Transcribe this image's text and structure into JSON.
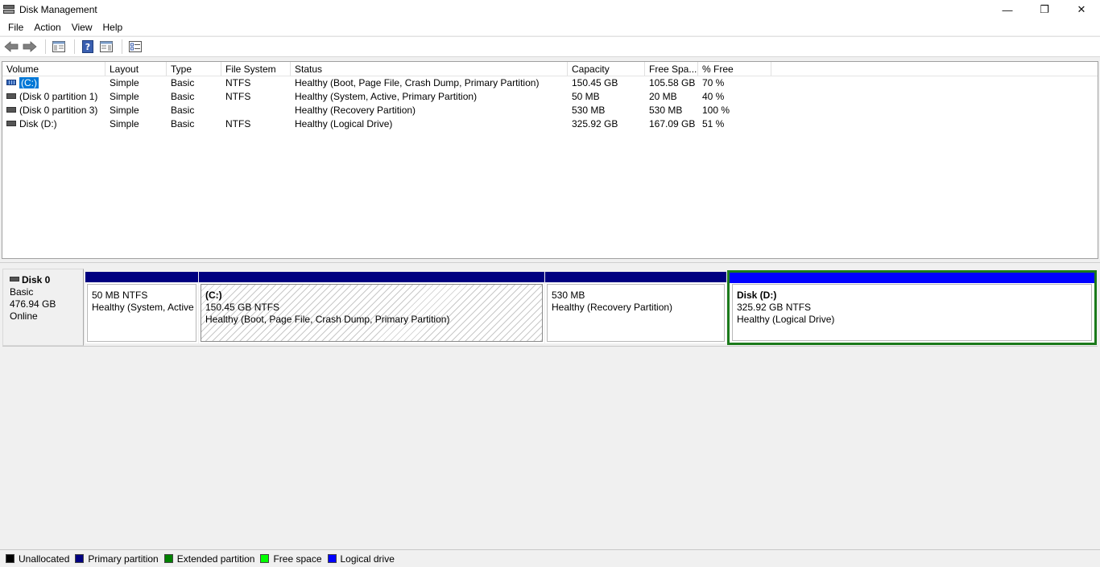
{
  "window": {
    "title": "Disk Management",
    "controls": {
      "minimize": "—",
      "restore": "❐",
      "close": "✕"
    }
  },
  "menu": [
    "File",
    "Action",
    "View",
    "Help"
  ],
  "toolbar": {
    "icons": [
      "back-arrow-icon",
      "forward-arrow-icon",
      "console-tree-icon",
      "help-icon",
      "action-pane-icon",
      "properties-icon"
    ]
  },
  "volume_list": {
    "columns": [
      "Volume",
      "Layout",
      "Type",
      "File System",
      "Status",
      "Capacity",
      "Free Spa...",
      "% Free"
    ],
    "rows": [
      {
        "volume": "(C:)",
        "layout": "Simple",
        "type": "Basic",
        "fs": "NTFS",
        "status": "Healthy (Boot, Page File, Crash Dump, Primary Partition)",
        "capacity": "150.45 GB",
        "free": "105.58 GB",
        "pct": "70 %",
        "selected": true
      },
      {
        "volume": "(Disk 0 partition 1)",
        "layout": "Simple",
        "type": "Basic",
        "fs": "NTFS",
        "status": "Healthy (System, Active, Primary Partition)",
        "capacity": "50 MB",
        "free": "20 MB",
        "pct": "40 %"
      },
      {
        "volume": "(Disk 0 partition 3)",
        "layout": "Simple",
        "type": "Basic",
        "fs": "",
        "status": "Healthy (Recovery Partition)",
        "capacity": "530 MB",
        "free": "530 MB",
        "pct": "100 %"
      },
      {
        "volume": "Disk (D:)",
        "layout": "Simple",
        "type": "Basic",
        "fs": "NTFS",
        "status": "Healthy (Logical Drive)",
        "capacity": "325.92 GB",
        "free": "167.09 GB",
        "pct": "51 %"
      }
    ]
  },
  "disk": {
    "name": "Disk 0",
    "type": "Basic",
    "size": "476.94 GB",
    "state": "Online",
    "partitions": [
      {
        "title": "",
        "size": "50 MB NTFS",
        "status": "Healthy (System, Active"
      },
      {
        "title": "(C:)",
        "size": "150.45 GB NTFS",
        "status": "Healthy (Boot, Page File, Crash Dump, Primary Partition)"
      },
      {
        "title": "",
        "size": "530 MB",
        "status": "Healthy (Recovery Partition)"
      },
      {
        "title": "Disk  (D:)",
        "size": "325.92 GB NTFS",
        "status": "Healthy (Logical Drive)"
      }
    ]
  },
  "legend": [
    {
      "label": "Unallocated",
      "color": "#000000"
    },
    {
      "label": "Primary partition",
      "color": "#000080"
    },
    {
      "label": "Extended partition",
      "color": "#008000"
    },
    {
      "label": "Free space",
      "color": "#00ff00"
    },
    {
      "label": "Logical drive",
      "color": "#0000ff"
    }
  ]
}
